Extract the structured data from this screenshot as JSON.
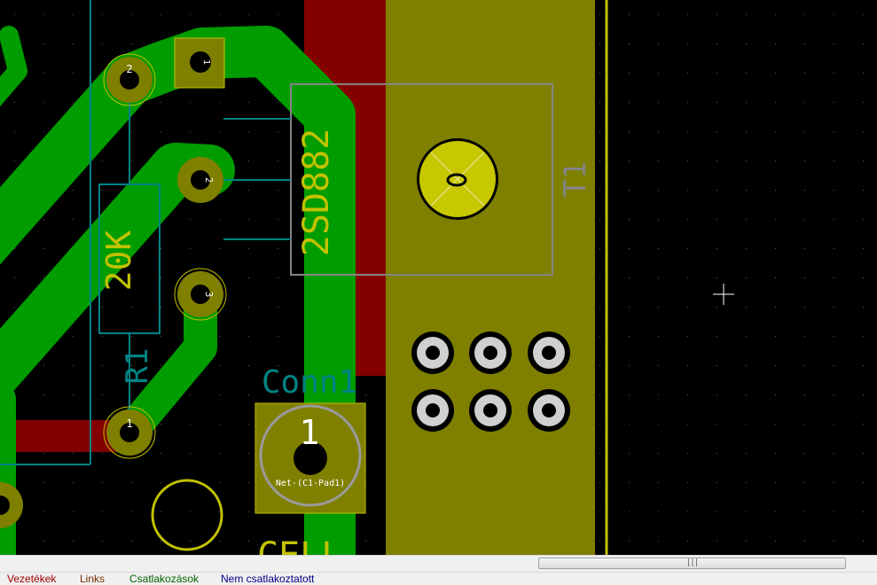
{
  "colors": {
    "background": "#000000",
    "copper_front": "#840000",
    "copper_back": "#009c00",
    "pad_fill": "#7f7f00",
    "silkscreen_yellow": "#c2c200",
    "silkscreen_cyan": "#008484",
    "board_edge": "#c2c200",
    "pad_outline": "#c2c200",
    "grey_outline": "#848484"
  },
  "components": {
    "r1": {
      "reference": "R1",
      "value": "20K"
    },
    "t1": {
      "reference": "T1",
      "value": "2SD882"
    },
    "conn1": {
      "reference": "Conn1",
      "pad_number": "1",
      "net_label": "Net-(C1-Pad1)"
    },
    "cell_label": "CELL-"
  },
  "pad_numbers": {
    "a": "1",
    "b": "2",
    "c": "3",
    "d": "2",
    "e": "1"
  },
  "scrollbar": {
    "grip": "|||"
  },
  "statusbar": {
    "items": [
      {
        "label": "Vezetékek",
        "color": "#a00000"
      },
      {
        "label": "Links",
        "color": "#7a2e00"
      },
      {
        "label": "Csatlakozások",
        "color": "#006400"
      },
      {
        "label": "Nem csatlakoztatott",
        "color": "#00008b"
      }
    ]
  },
  "cursor_icon": "crosshair-icon"
}
